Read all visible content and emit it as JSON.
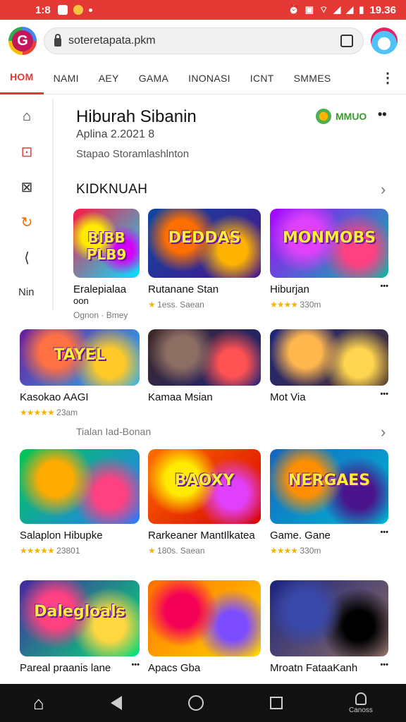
{
  "statusbar": {
    "left_text": "1:8",
    "time": "19.36"
  },
  "browser": {
    "url": "soteretapata.pkm",
    "logo_letter": "G"
  },
  "nav": {
    "tabs": [
      "HOM",
      "NAMI",
      "AEY",
      "GAMA",
      "INONASI",
      "ICNT",
      "SMMES"
    ]
  },
  "sidebar": {
    "label": "Nin"
  },
  "app": {
    "title": "Hiburah Sibanin",
    "subtitle": "Aplina 2.2021 8",
    "description": "Stapao Storamlashlnton",
    "badge": "MMUO"
  },
  "section": {
    "title": "KIDKNUAH",
    "subtitle": "Tialan Iad-Bonan"
  },
  "cards": [
    {
      "thumb_title": "BIBB PLB9",
      "name": "Eralepialaa",
      "name2": "oon",
      "meta": "Ognon · Bmey",
      "rating": "",
      "colors": [
        "#ff1744",
        "#ffea00",
        "#00e5ff",
        "#d500f9"
      ]
    },
    {
      "thumb_title": "DEDDAS",
      "name": "Rutanane Stan",
      "meta": "1ess. Saean",
      "rating": "★",
      "colors": [
        "#0d47a1",
        "#ff6f00",
        "#4a148c",
        "#ffb300"
      ]
    },
    {
      "thumb_title": "MONMOBS",
      "name": "Hiburjan",
      "meta": "330m",
      "rating": "★★★★",
      "colors": [
        "#aa00ff",
        "#e040fb",
        "#00bfa5",
        "#ff4081"
      ]
    },
    {
      "thumb_title": "TAYEL",
      "name": "Kasokao AAGI",
      "meta": "23am",
      "rating": "★★★★★",
      "colors": [
        "#6a1b9a",
        "#ff7043",
        "#29b6f6",
        "#ffca28"
      ]
    },
    {
      "thumb_title": "",
      "name": "Kamaa Msian",
      "meta": "",
      "rating": "",
      "colors": [
        "#3e2723",
        "#8d6e63",
        "#1a237e",
        "#ff5252"
      ]
    },
    {
      "thumb_title": "",
      "name": "Mot Via",
      "meta": "",
      "rating": "",
      "colors": [
        "#1a237e",
        "#ffb74d",
        "#4e342e",
        "#ffd54f"
      ]
    },
    {
      "thumb_title": "",
      "name": "Salaplon Hibupke",
      "meta": "23801",
      "rating": "★★★★★",
      "colors": [
        "#00c853",
        "#ffab00",
        "#2979ff",
        "#ff4081"
      ]
    },
    {
      "thumb_title": "BAOXY",
      "name": "Rarkeaner MantIlkatea",
      "meta": "180s. Saean",
      "rating": "★",
      "colors": [
        "#ff6d00",
        "#ffea00",
        "#d50000",
        "#e040fb"
      ]
    },
    {
      "thumb_title": "NERGAES",
      "name": "Game. Gane",
      "meta": "330m",
      "rating": "★★★★",
      "colors": [
        "#1565c0",
        "#ff8f00",
        "#00b8d4",
        "#4a148c"
      ]
    },
    {
      "thumb_title": "Dalegloals",
      "name": "Pareal praanis lane",
      "meta": "",
      "rating": "",
      "colors": [
        "#4527a0",
        "#ff4081",
        "#00e676",
        "#ffd740"
      ]
    },
    {
      "thumb_title": "",
      "name": "Apacs Gba",
      "meta": "",
      "rating": "",
      "colors": [
        "#ff6f00",
        "#f50057",
        "#ffd600",
        "#7c4dff"
      ]
    },
    {
      "thumb_title": "",
      "name": "Mroatn FataaKanh",
      "meta": "",
      "rating": "",
      "colors": [
        "#1a237e",
        "#3949ab",
        "#8d6e63",
        "#000000"
      ]
    }
  ],
  "bottom": {
    "user_label": "Canoss"
  }
}
